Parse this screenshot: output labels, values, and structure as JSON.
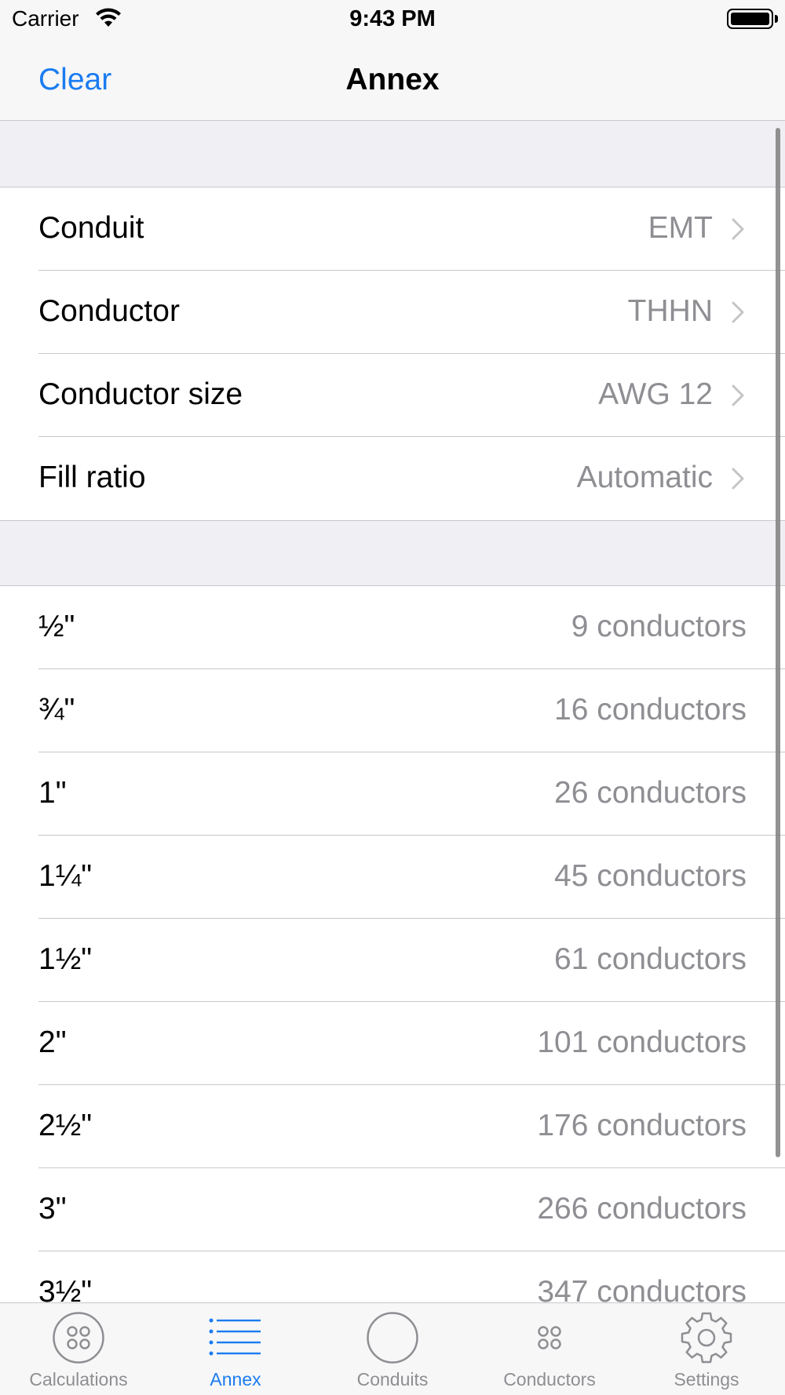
{
  "status_bar": {
    "carrier": "Carrier",
    "time": "9:43 PM"
  },
  "nav": {
    "left_button": "Clear",
    "title": "Annex"
  },
  "settings": [
    {
      "label": "Conduit",
      "value": "EMT"
    },
    {
      "label": "Conductor",
      "value": "THHN"
    },
    {
      "label": "Conductor size",
      "value": "AWG 12"
    },
    {
      "label": "Fill ratio",
      "value": "Automatic"
    }
  ],
  "results": [
    {
      "size": "½\"",
      "count": "9 conductors"
    },
    {
      "size": "¾\"",
      "count": "16 conductors"
    },
    {
      "size": "1\"",
      "count": "26 conductors"
    },
    {
      "size": "1¼\"",
      "count": "45 conductors"
    },
    {
      "size": "1½\"",
      "count": "61 conductors"
    },
    {
      "size": "2\"",
      "count": "101 conductors"
    },
    {
      "size": "2½\"",
      "count": "176 conductors"
    },
    {
      "size": "3\"",
      "count": "266 conductors"
    },
    {
      "size": "3½\"",
      "count": "347 conductors"
    }
  ],
  "tabs": [
    {
      "label": "Calculations",
      "icon": "calculations-icon"
    },
    {
      "label": "Annex",
      "icon": "list-icon",
      "active": true
    },
    {
      "label": "Conduits",
      "icon": "circle-icon"
    },
    {
      "label": "Conductors",
      "icon": "conductors-icon"
    },
    {
      "label": "Settings",
      "icon": "gear-icon"
    }
  ],
  "colors": {
    "accent": "#1a7cf0",
    "secondary_text": "#8e8e93",
    "separator": "#c8c7cc",
    "grouped_background": "#efeff4"
  }
}
